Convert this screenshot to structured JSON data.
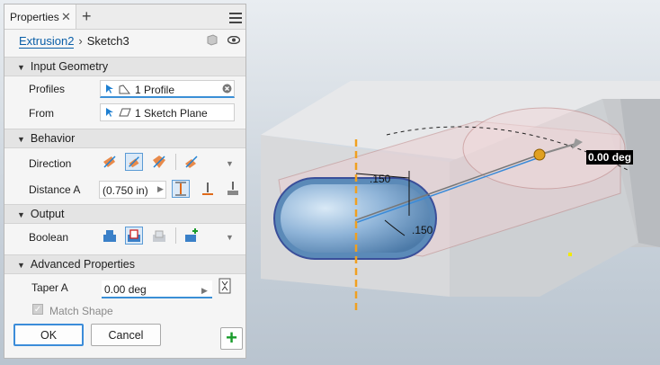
{
  "tab": {
    "title": "Properties",
    "close": "✕",
    "add": "+"
  },
  "breadcrumb": {
    "feature": "Extrusion2",
    "separator": "›",
    "sketch": "Sketch3"
  },
  "sections": {
    "input_geometry": "Input Geometry",
    "behavior": "Behavior",
    "output": "Output",
    "advanced": "Advanced Properties"
  },
  "input_geometry": {
    "profiles_label": "Profiles",
    "profiles_value": "1 Profile",
    "from_label": "From",
    "from_value": "1 Sketch Plane"
  },
  "behavior": {
    "direction_label": "Direction",
    "distance_label": "Distance A",
    "distance_value": "(0.750 in)"
  },
  "output": {
    "boolean_label": "Boolean"
  },
  "advanced": {
    "taper_label": "Taper A",
    "taper_value": "0.00 deg",
    "match_shape_label": "Match Shape",
    "match_shape_checked": true
  },
  "footer": {
    "ok": "OK",
    "cancel": "Cancel"
  },
  "viewport": {
    "dim1": ".150",
    "dim2": ".150",
    "angle": "0.00 deg"
  },
  "colors": {
    "accent": "#3a8fd6",
    "link": "#0a5fa8",
    "add": "#1a9c2c",
    "sketch_line": "#f0a020"
  }
}
